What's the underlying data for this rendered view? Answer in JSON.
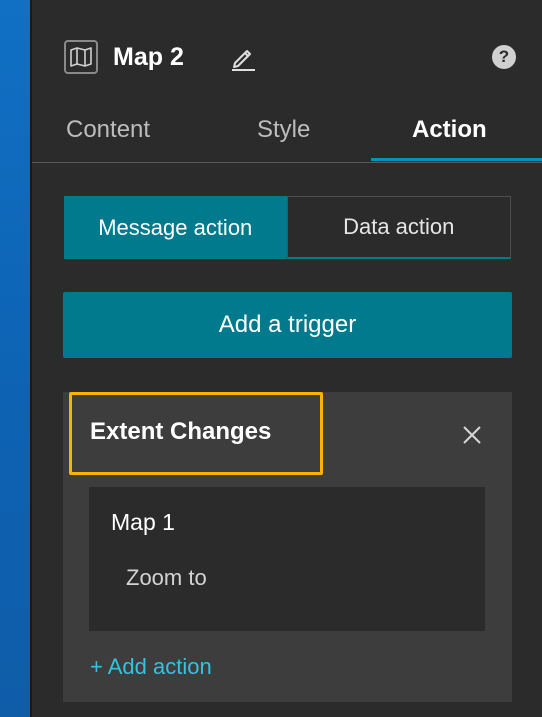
{
  "header": {
    "title": "Map 2",
    "icons": [
      "map-icon",
      "pencil-icon",
      "help-icon"
    ],
    "help_glyph": "?"
  },
  "tabs": [
    {
      "label": "Content",
      "active": false
    },
    {
      "label": "Style",
      "active": false
    },
    {
      "label": "Action",
      "active": true
    }
  ],
  "action_type": {
    "options": [
      "Message action",
      "Data action"
    ],
    "selected": "Message action"
  },
  "add_trigger_label": "Add a trigger",
  "trigger": {
    "name": "Extent Changes",
    "close_icon": "close-icon",
    "action": {
      "target": "Map 1",
      "name": "Zoom to"
    },
    "add_action_label": "+ Add action"
  },
  "colors": {
    "background_blue": "#1170c4",
    "panel": "#2b2b2b",
    "card": "#3d3d3d",
    "accent_teal": "#007a8c",
    "highlight": "#f5b400",
    "link": "#33c2e0"
  }
}
